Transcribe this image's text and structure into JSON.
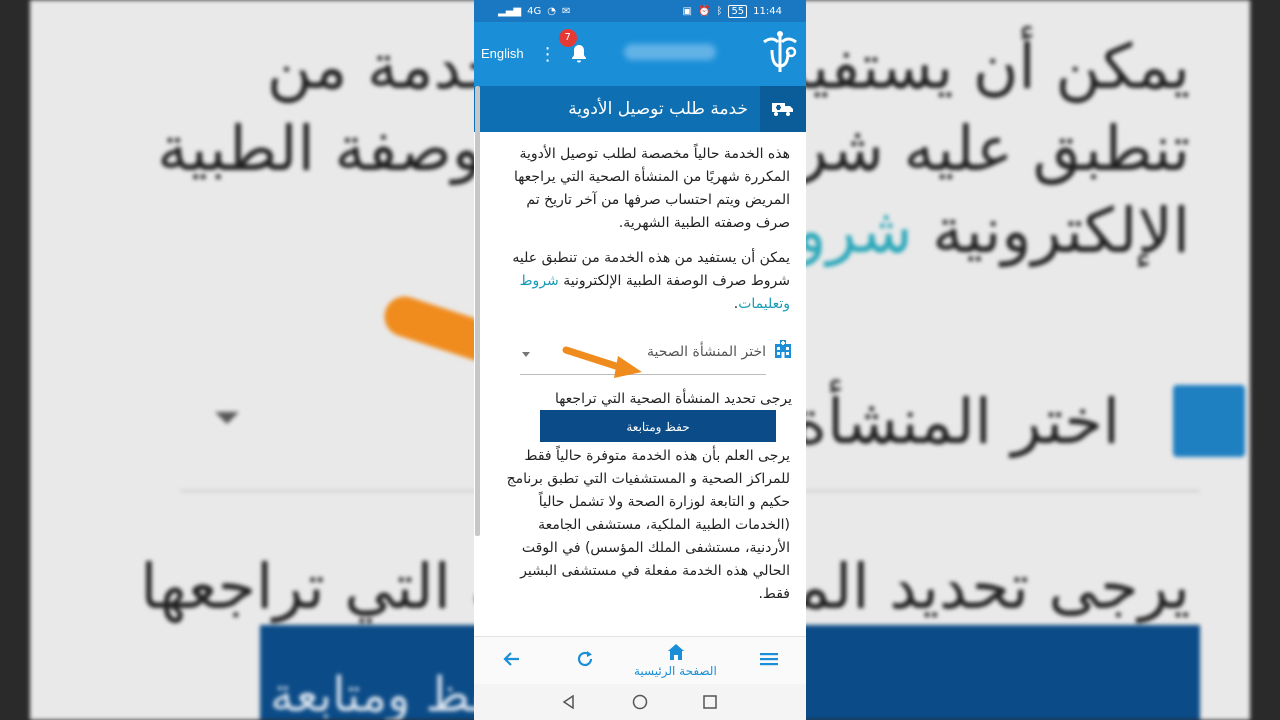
{
  "status_bar": {
    "time": "11:44",
    "battery": "55",
    "signal": "4G"
  },
  "app_bar": {
    "language_button": "English",
    "notification_count": "7",
    "icons": [
      "kebab-menu-icon",
      "bell-icon",
      "health-logo-icon"
    ]
  },
  "section": {
    "title": "خدمة طلب توصيل الأدوية",
    "icon": "truck-icon"
  },
  "content": {
    "para1": "هذه الخدمة حالياً مخصصة لطلب توصيل الأدوية المكررة شهريًا من المنشأة الصحية التي يراجعها المريض ويتم احتساب صرفها من آخر تاريخ تم صرف وصفته الطبية الشهرية.",
    "para2_text": "يمكن أن يستفيد من هذه الخدمة من تنطبق عليه شروط صرف الوصفة الطبية الإلكترونية ",
    "para2_link": "شروط وتعليمات",
    "para2_end": ".",
    "select_placeholder": "اختر المنشأة الصحية",
    "hint": "يرجى تحديد المنشأة الصحية التي تراجعها",
    "save_button": "حفظ ومتابعة",
    "para3": "يرجى العلم بأن هذه الخدمة متوفرة حالياً فقط للمراكز الصحية و المستشفيات التي تطبق برنامج حكيم و التابعة لوزارة الصحة ولا تشمل حالياً (الخدمات الطبية الملكية، مستشفى الجامعة الأردنية، مستشفى الملك المؤسس) في الوقت الحالي هذه الخدمة مفعلة في مستشفى البشير فقط."
  },
  "bottom_nav": {
    "home_label": "الصفحة الرئيسية",
    "icons": [
      "back-arrow-icon",
      "refresh-icon",
      "home-icon",
      "hamburger-menu-icon"
    ]
  },
  "background": {
    "line1": "يمكن أن يستفيد من هذه الخدمة من",
    "line2": "تنطبق عليه شروط صرف الوصفة الطبية",
    "line3a": "الإلكترونية ",
    "line3b": "شروط وتعليمات",
    "line4": "اختر المنشأة الصحية",
    "line5": "يرجى تحديد المنشأة الصحية التي تراجعها",
    "line6": "حفظ ومتابعة"
  },
  "colors": {
    "primary": "#1a8fd8",
    "header": "#0e6fb3",
    "button": "#0b4b87",
    "link": "#1a9bb5",
    "arrow": "#f08c1e"
  }
}
